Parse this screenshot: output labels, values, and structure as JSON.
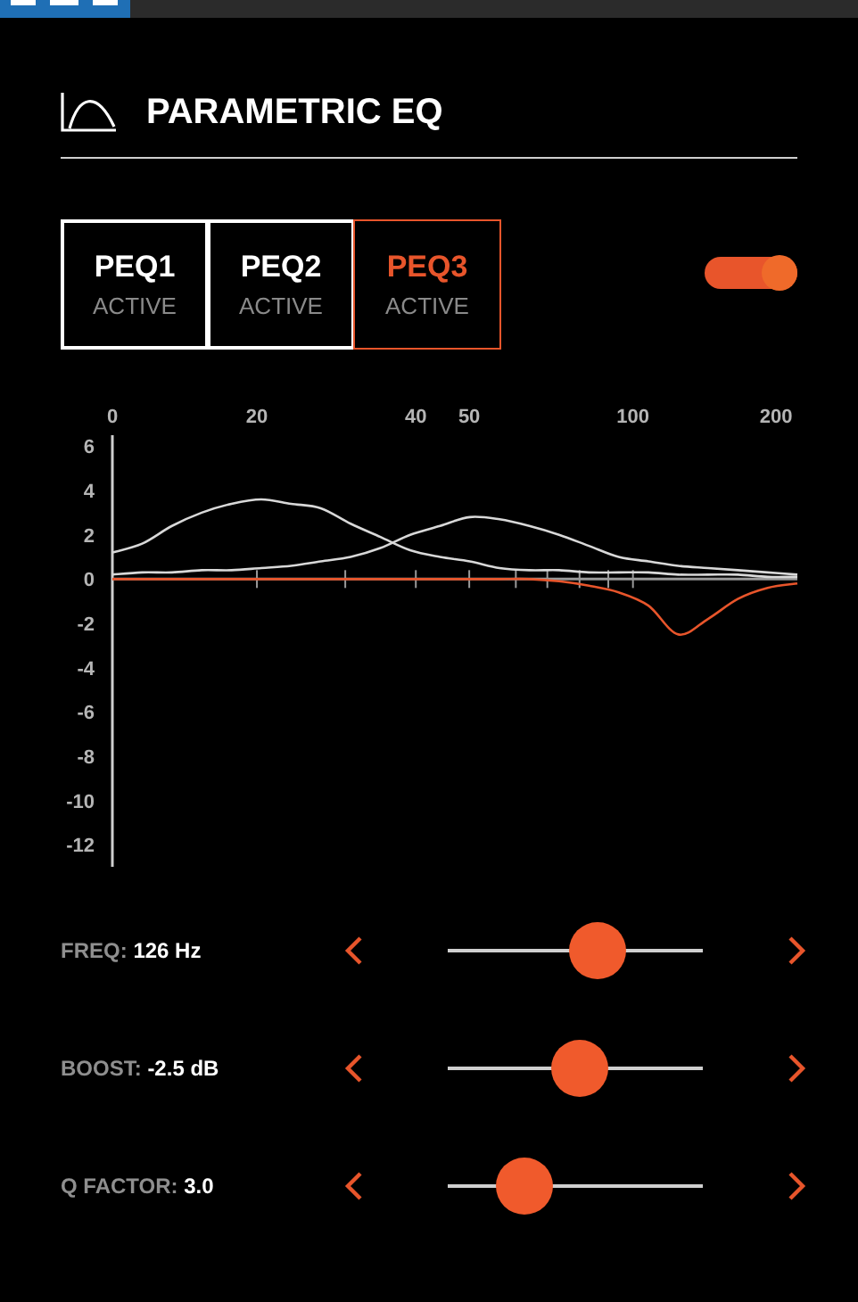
{
  "title": "PARAMETRIC EQ",
  "tabs": [
    {
      "label": "PEQ1",
      "status": "ACTIVE",
      "selected": false
    },
    {
      "label": "PEQ2",
      "status": "ACTIVE",
      "selected": false
    },
    {
      "label": "PEQ3",
      "status": "ACTIVE",
      "selected": true
    }
  ],
  "toggle": {
    "on": true
  },
  "chart": {
    "x_axis_labels": [
      "0",
      "20",
      "40",
      "50",
      "100",
      "200"
    ],
    "chart_data": {
      "type": "line",
      "ylim": [
        -13,
        6.5
      ],
      "yticks": [
        6,
        4,
        2,
        0,
        -2,
        -4,
        -6,
        -8,
        -10,
        -12
      ],
      "series": [
        {
          "color": "#d8d8d8",
          "values": [
            1.2,
            1.6,
            2.4,
            3.0,
            3.4,
            3.6,
            3.4,
            3.2,
            2.5,
            1.9,
            1.3,
            1.0,
            0.8,
            0.5,
            0.4,
            0.4,
            0.3,
            0.3,
            0.3,
            0.2,
            0.2,
            0.2,
            0.1,
            0.1
          ]
        },
        {
          "color": "#d8d8d8",
          "values": [
            0.2,
            0.3,
            0.3,
            0.4,
            0.4,
            0.5,
            0.6,
            0.8,
            1.0,
            1.4,
            2.0,
            2.4,
            2.8,
            2.7,
            2.4,
            2.0,
            1.5,
            1.0,
            0.8,
            0.6,
            0.5,
            0.4,
            0.3,
            0.2
          ]
        },
        {
          "color": "#e8552b",
          "values": [
            0,
            0,
            0,
            0,
            0,
            0,
            0,
            0,
            0,
            0,
            0,
            0,
            0,
            0,
            0,
            -0.1,
            -0.3,
            -0.6,
            -1.2,
            -2.5,
            -1.8,
            -0.9,
            -0.4,
            -0.2
          ]
        }
      ]
    }
  },
  "params": [
    {
      "label": "FREQ:",
      "value": "126 Hz",
      "level": 0.585
    },
    {
      "label": "BOOST:",
      "value": "-2.5 dB",
      "level": 0.52
    },
    {
      "label": "Q FACTOR:",
      "value": "3.0",
      "level": 0.3
    }
  ]
}
